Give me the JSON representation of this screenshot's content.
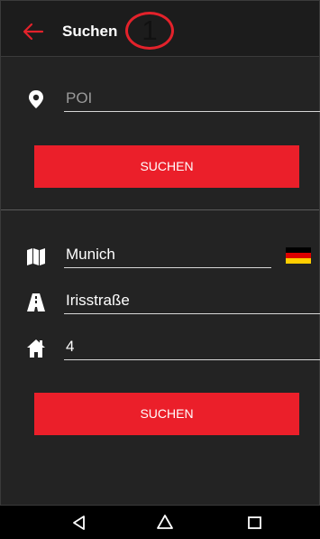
{
  "header": {
    "title": "Suchen",
    "marker": "1"
  },
  "poi": {
    "placeholder": "POI",
    "button_label": "SUCHEN"
  },
  "address": {
    "city": "Munich",
    "street": "Irisstraße",
    "house_number": "4",
    "country_flag": "germany-flag-icon",
    "button_label": "SUCHEN"
  },
  "colors": {
    "accent": "#eb1f2a",
    "background": "#232323"
  },
  "navbar": {
    "icons": [
      "back-triangle-icon",
      "home-circle-icon",
      "recents-square-icon"
    ]
  }
}
